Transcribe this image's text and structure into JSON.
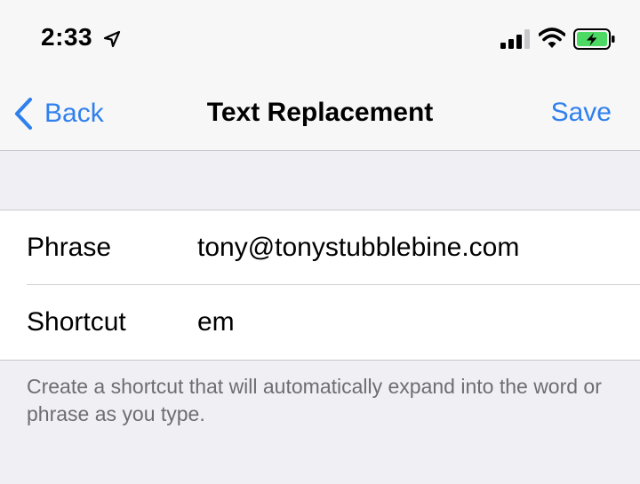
{
  "status_bar": {
    "time": "2:33",
    "icons": [
      "location-arrow-icon",
      "cellular-signal-icon",
      "wifi-icon",
      "battery-charging-icon"
    ],
    "battery_color": "#4cd964"
  },
  "nav": {
    "back_label": "Back",
    "title": "Text Replacement",
    "save_label": "Save",
    "accent_color": "#2f80ed"
  },
  "form": {
    "rows": [
      {
        "label": "Phrase",
        "value": "tony@tonystubblebine.com"
      },
      {
        "label": "Shortcut",
        "value": "em"
      }
    ]
  },
  "footer": {
    "note": "Create a shortcut that will automatically expand into the word or phrase as you type."
  }
}
